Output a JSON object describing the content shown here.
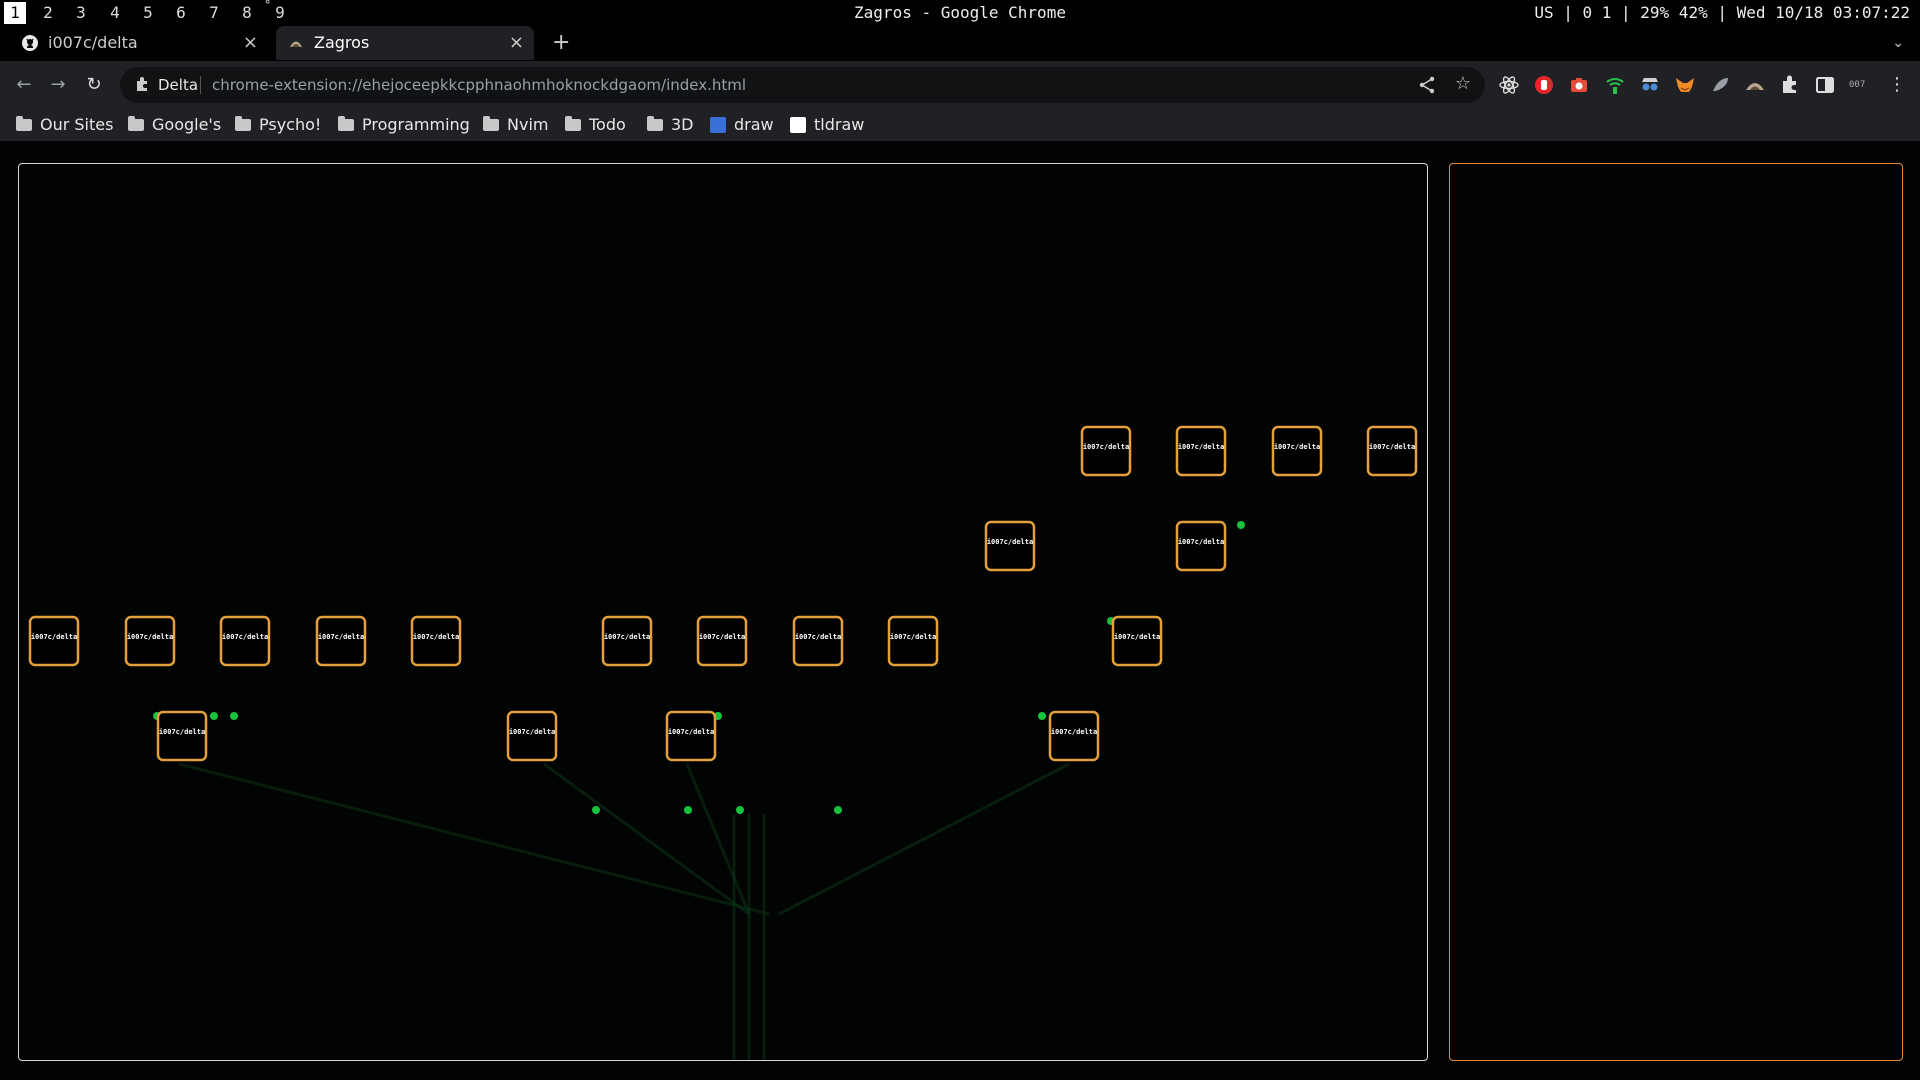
{
  "system_bar": {
    "workspaces": [
      "1",
      "2",
      "3",
      "4",
      "5",
      "6",
      "7",
      "8",
      "9"
    ],
    "window_title": "Zagros - Google Chrome",
    "status": "US | 0 1 | 29% 42% | Wed 10/18 03:07:22"
  },
  "tabs": [
    {
      "label": "i007c/delta",
      "close": "×",
      "icon": "github-icon"
    },
    {
      "label": "Zagros",
      "close": "×",
      "icon": "zagros-icon"
    }
  ],
  "tabstrip": {
    "new_tab": "+",
    "tab_list": "⌄"
  },
  "toolbar": {
    "back": "←",
    "forward": "→",
    "reload": "↻",
    "site_chip": "Delta",
    "url": "chrome-extension://ehejoceepkkcpphnaohmhoknockdgaom/index.html",
    "star": "☆",
    "ext_label_007": "007",
    "menu": "⋮"
  },
  "bookmarks": [
    {
      "label": "Our Sites",
      "type": "folder"
    },
    {
      "label": "Google's",
      "type": "folder"
    },
    {
      "label": "Psycho!",
      "type": "folder"
    },
    {
      "label": "Programming",
      "type": "folder"
    },
    {
      "label": "Nvim",
      "type": "folder"
    },
    {
      "label": "Todo",
      "type": "folder"
    },
    {
      "label": "3D",
      "type": "folder"
    },
    {
      "label": "draw",
      "type": "app"
    },
    {
      "label": "tldraw",
      "type": "app"
    }
  ],
  "graph": {
    "node_label": "i007c/delta",
    "colors": {
      "node_border": "#e3a03c",
      "edge": "#18c23c",
      "main_border": "#d7d7d7",
      "side_border": "#e08b33"
    }
  }
}
